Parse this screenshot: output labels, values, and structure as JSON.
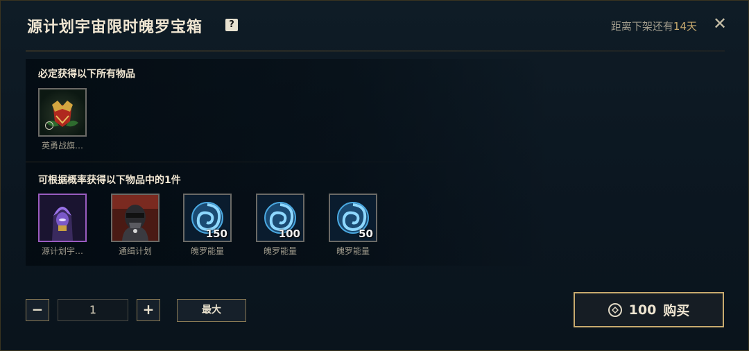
{
  "header": {
    "title": "源计划宇宙限时魄罗宝箱",
    "help_label": "?",
    "timer_prefix": "距离下架还有",
    "timer_value": "14天",
    "close_label": "✕"
  },
  "guaranteed": {
    "title": "必定获得以下所有物品",
    "items": [
      {
        "label": "英勇战旗…",
        "icon": "valor-banner-icon",
        "timed": true
      }
    ]
  },
  "chance": {
    "title": "可根据概率获得以下物品中的1件",
    "items": [
      {
        "label": "源计划宇…",
        "icon": "project-skin-icon",
        "qty": ""
      },
      {
        "label": "通缉计划",
        "icon": "wanted-project-icon",
        "qty": ""
      },
      {
        "label": "魄罗能量",
        "icon": "poro-energy-icon",
        "qty": "150"
      },
      {
        "label": "魄罗能量",
        "icon": "poro-energy-icon",
        "qty": "100"
      },
      {
        "label": "魄罗能量",
        "icon": "poro-energy-icon",
        "qty": "50"
      }
    ]
  },
  "controls": {
    "minus_label": "−",
    "quantity_value": "1",
    "plus_label": "+",
    "max_label": "最大",
    "price": "100",
    "buy_label": "购买"
  },
  "colors": {
    "gold_accent": "#c8aa6e",
    "rare_border": "#9a5cc0",
    "background": "#0f1c26"
  }
}
